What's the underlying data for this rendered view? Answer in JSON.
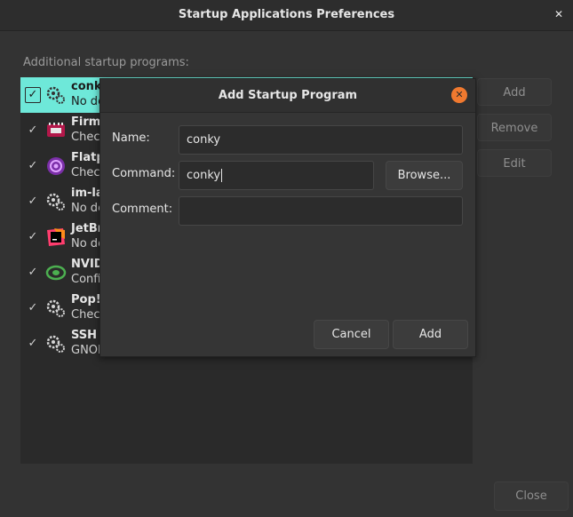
{
  "window": {
    "title": "Startup Applications Preferences"
  },
  "main": {
    "section_label": "Additional startup programs:",
    "programs": [
      {
        "name": "conky",
        "description": "No description",
        "checked": true,
        "selected": true,
        "icon": "gears-icon"
      },
      {
        "name": "Firmware",
        "description": "Check for firmware updates",
        "checked": true,
        "icon": "firmware-chip-icon"
      },
      {
        "name": "Flatpak",
        "description": "Check for Flatpak updates",
        "checked": true,
        "icon": "flatpak-icon"
      },
      {
        "name": "im-launch",
        "description": "No description",
        "checked": true,
        "icon": "gears-icon"
      },
      {
        "name": "JetBrains Toolbox",
        "description": "No description",
        "checked": true,
        "icon": "jetbrains-icon"
      },
      {
        "name": "NVIDIA",
        "description": "Configure NVIDIA settings",
        "checked": true,
        "icon": "nvidia-icon"
      },
      {
        "name": "Pop!_OS",
        "description": "Check for updates",
        "checked": true,
        "icon": "gears-icon"
      },
      {
        "name": "SSH Key Agent",
        "description": "GNOME Keyring: SSH Agent",
        "checked": true,
        "icon": "gears-icon"
      }
    ]
  },
  "side_buttons": {
    "add": "Add",
    "remove": "Remove",
    "edit": "Edit"
  },
  "footer": {
    "close": "Close"
  },
  "dialog": {
    "title": "Add Startup Program",
    "name_label": "Name:",
    "name_value": "conky",
    "command_label": "Command:",
    "command_value": "conky",
    "browse": "Browse...",
    "comment_label": "Comment:",
    "comment_value": "",
    "cancel": "Cancel",
    "add": "Add"
  },
  "colors": {
    "accent": "#6ee8d9",
    "close_orange": "#f0792f",
    "background": "#333333"
  }
}
